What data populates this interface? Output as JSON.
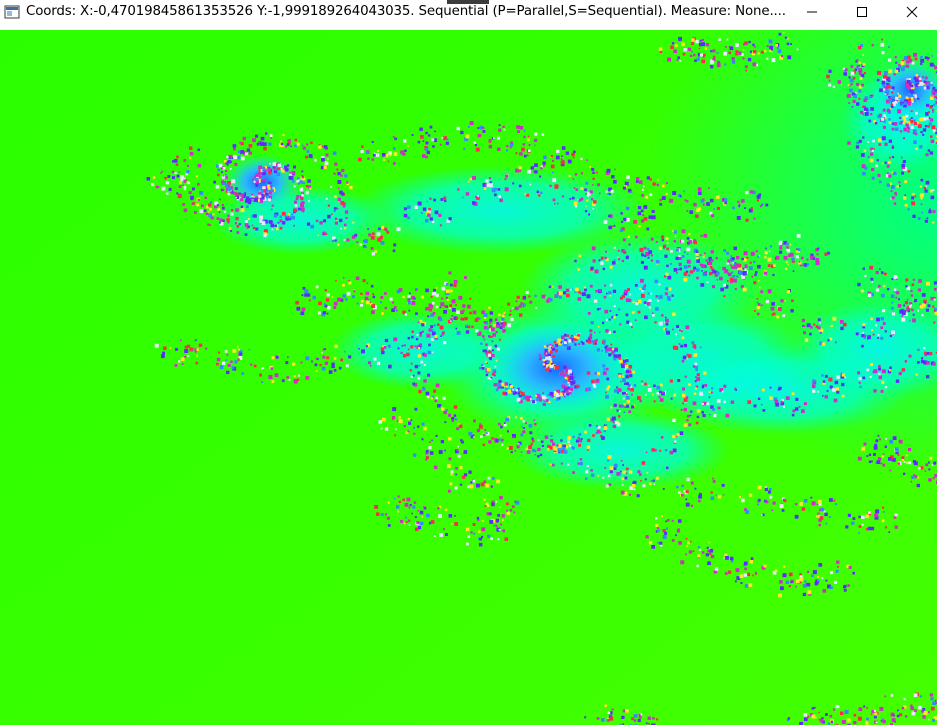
{
  "window": {
    "title": "Coords: X:-0,47019845861353526 Y:-1,999189264043035. Sequential (P=Parallel,S=Sequential). Measure: None...."
  },
  "caption_buttons": {
    "minimize": "minimize-icon",
    "maximize": "maximize-icon",
    "close": "close-icon"
  },
  "fractal": {
    "kind": "Julia set",
    "background_color": "#33ff00",
    "colors": {
      "outer": "#22ff00",
      "glow": "#00ffee",
      "mid": "#2f8cff",
      "dust_blue": "#5a2cff",
      "dust_magenta": "#d02cc8",
      "dust_red": "#ff2a4a",
      "dust_yellow": "#ffe62a",
      "dust_white": "#e8e8ff"
    }
  }
}
